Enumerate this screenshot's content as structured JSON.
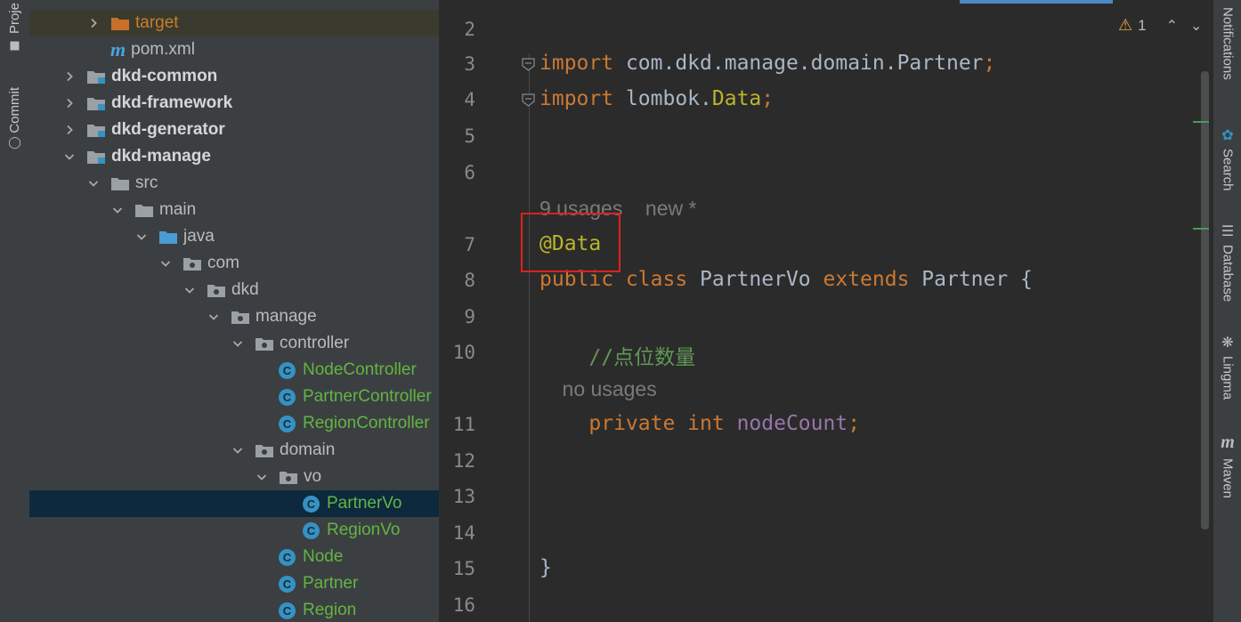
{
  "left_strip": {
    "project_label": "Proje",
    "commit_label": "Commit"
  },
  "tree": [
    {
      "label": "target",
      "type": "folder-orange",
      "depth": 2,
      "expand": "collapsed",
      "style": "orange",
      "highlighted": true
    },
    {
      "label": "pom.xml",
      "type": "maven",
      "depth": 2,
      "expand": "none"
    },
    {
      "label": "dkd-common",
      "type": "module",
      "depth": 1,
      "expand": "collapsed",
      "style": "bold"
    },
    {
      "label": "dkd-framework",
      "type": "module",
      "depth": 1,
      "expand": "collapsed",
      "style": "bold"
    },
    {
      "label": "dkd-generator",
      "type": "module",
      "depth": 1,
      "expand": "collapsed",
      "style": "bold"
    },
    {
      "label": "dkd-manage",
      "type": "module",
      "depth": 1,
      "expand": "expanded",
      "style": "bold"
    },
    {
      "label": "src",
      "type": "folder",
      "depth": 2,
      "expand": "expanded"
    },
    {
      "label": "main",
      "type": "folder",
      "depth": 3,
      "expand": "expanded"
    },
    {
      "label": "java",
      "type": "folder-blue",
      "depth": 4,
      "expand": "expanded"
    },
    {
      "label": "com",
      "type": "package",
      "depth": 5,
      "expand": "expanded"
    },
    {
      "label": "dkd",
      "type": "package",
      "depth": 6,
      "expand": "expanded"
    },
    {
      "label": "manage",
      "type": "package",
      "depth": 7,
      "expand": "expanded"
    },
    {
      "label": "controller",
      "type": "package",
      "depth": 8,
      "expand": "expanded"
    },
    {
      "label": "NodeController",
      "type": "class",
      "depth": 9,
      "expand": "none",
      "style": "green"
    },
    {
      "label": "PartnerController",
      "type": "class",
      "depth": 9,
      "expand": "none",
      "style": "green"
    },
    {
      "label": "RegionController",
      "type": "class",
      "depth": 9,
      "expand": "none",
      "style": "green"
    },
    {
      "label": "domain",
      "type": "package",
      "depth": 8,
      "expand": "expanded"
    },
    {
      "label": "vo",
      "type": "package",
      "depth": 9,
      "expand": "expanded"
    },
    {
      "label": "PartnerVo",
      "type": "class",
      "depth": 10,
      "expand": "none",
      "style": "green",
      "selected": true
    },
    {
      "label": "RegionVo",
      "type": "class",
      "depth": 10,
      "expand": "none",
      "style": "green"
    },
    {
      "label": "Node",
      "type": "class",
      "depth": 9,
      "expand": "none",
      "style": "green"
    },
    {
      "label": "Partner",
      "type": "class",
      "depth": 9,
      "expand": "none",
      "style": "green"
    },
    {
      "label": "Region",
      "type": "class",
      "depth": 9,
      "expand": "none",
      "style": "green"
    }
  ],
  "editor": {
    "warning_count": "1",
    "lines": [
      {
        "n": "2",
        "tokens": []
      },
      {
        "n": "3",
        "tokens": [
          {
            "t": "import",
            "c": "kw"
          },
          {
            "t": " com.dkd.manage.domain.Partner",
            "c": ""
          },
          {
            "t": ";",
            "c": "kw"
          }
        ],
        "fold": true
      },
      {
        "n": "4",
        "tokens": [
          {
            "t": "import",
            "c": "kw"
          },
          {
            "t": " lombok.",
            "c": ""
          },
          {
            "t": "Data",
            "c": "ann"
          },
          {
            "t": ";",
            "c": "kw"
          }
        ],
        "fold": true
      },
      {
        "n": "5",
        "tokens": []
      },
      {
        "n": "6",
        "tokens": []
      },
      {
        "hint": "9 usages    new *"
      },
      {
        "n": "7",
        "tokens": [
          {
            "t": "@Data",
            "c": "ann"
          }
        ]
      },
      {
        "n": "8",
        "tokens": [
          {
            "t": "public class",
            "c": "kw"
          },
          {
            "t": " PartnerVo ",
            "c": ""
          },
          {
            "t": "extends",
            "c": "kw"
          },
          {
            "t": " Partner {",
            "c": ""
          }
        ]
      },
      {
        "n": "9",
        "tokens": []
      },
      {
        "n": "10",
        "tokens": [
          {
            "t": "    //点位数量",
            "c": "cmt"
          }
        ]
      },
      {
        "hint": "    no usages"
      },
      {
        "n": "11",
        "tokens": [
          {
            "t": "    private int",
            "c": "kw"
          },
          {
            "t": " nodeCount",
            "c": "field"
          },
          {
            "t": ";",
            "c": "kw"
          }
        ]
      },
      {
        "n": "12",
        "tokens": []
      },
      {
        "n": "13",
        "tokens": []
      },
      {
        "n": "14",
        "tokens": []
      },
      {
        "n": "15",
        "tokens": [
          {
            "t": "}",
            "c": ""
          }
        ]
      },
      {
        "n": "16",
        "tokens": []
      }
    ]
  },
  "right_strip": {
    "notifications_label": "Notifications",
    "search_label": "Search",
    "database_label": "Database",
    "lingma_label": "Lingma",
    "maven_label": "Maven"
  }
}
